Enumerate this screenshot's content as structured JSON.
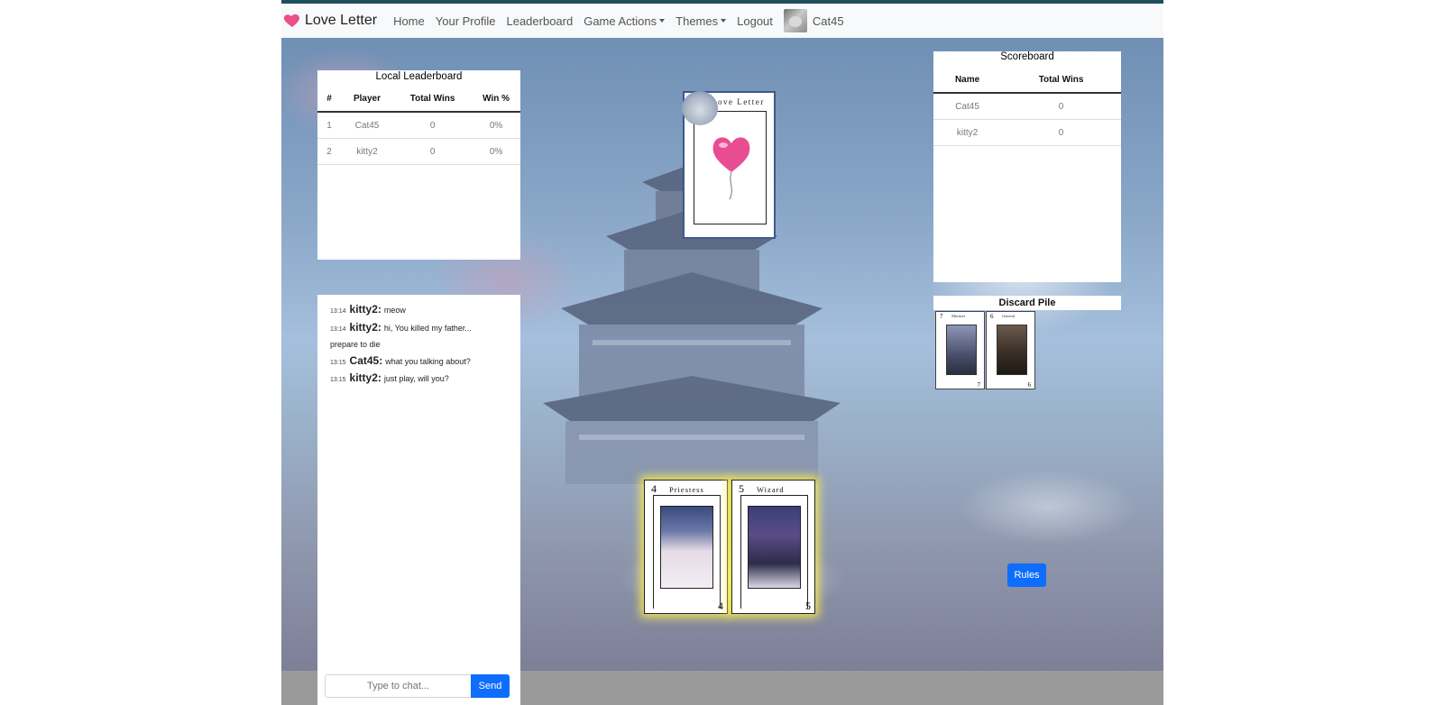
{
  "app": {
    "brand": "Love Letter"
  },
  "nav": {
    "home": "Home",
    "profile": "Your Profile",
    "leaderboard": "Leaderboard",
    "game_actions": "Game Actions",
    "themes": "Themes",
    "logout": "Logout",
    "username": "Cat45"
  },
  "local_leaderboard": {
    "title": "Local Leaderboard",
    "headers": [
      "#",
      "Player",
      "Total Wins",
      "Win %"
    ],
    "rows": [
      [
        "1",
        "Cat45",
        "0",
        "0%"
      ],
      [
        "2",
        "kitty2",
        "0",
        "0%"
      ]
    ]
  },
  "scoreboard": {
    "title": "Scoreboard",
    "headers": [
      "Name",
      "Total Wins"
    ],
    "rows": [
      [
        "Cat45",
        "0"
      ],
      [
        "kitty2",
        "0"
      ]
    ]
  },
  "deck": {
    "title": "Love Letter"
  },
  "discard": {
    "title": "Discard Pile",
    "cards": [
      {
        "number": "7",
        "name": "Minister"
      },
      {
        "number": "6",
        "name": "General"
      }
    ]
  },
  "chat": {
    "messages": [
      {
        "time": "13:14",
        "user": "kitty2:",
        "text": "meow"
      },
      {
        "time": "13:14",
        "user": "kitty2:",
        "text": "hi, You killed my father... prepare to die"
      },
      {
        "time": "13:15",
        "user": "Cat45:",
        "text": "what you talking about?"
      },
      {
        "time": "13:15",
        "user": "kitty2:",
        "text": "just play, will you?"
      }
    ],
    "placeholder": "Type to chat...",
    "send_label": "Send"
  },
  "hand": [
    {
      "number": "4",
      "name": "Priestess"
    },
    {
      "number": "5",
      "name": "Wizard"
    }
  ],
  "rules_label": "Rules",
  "colors": {
    "primary": "#0d6efd",
    "highlight": "#fff050",
    "navbar_bg": "#f8f9fa"
  }
}
